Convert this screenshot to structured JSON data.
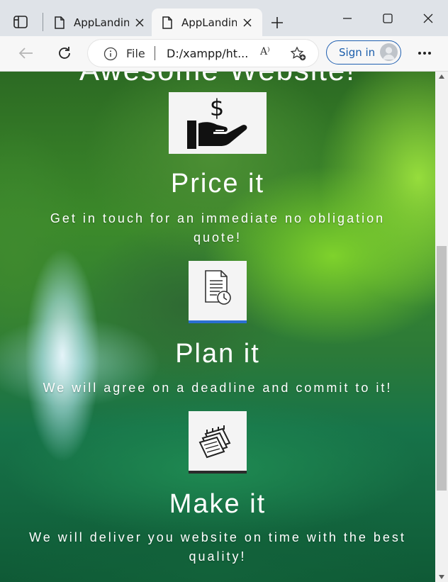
{
  "window": {
    "tabs": [
      {
        "title": "AppLanding",
        "active": false
      },
      {
        "title": "AppLanding",
        "active": true
      }
    ],
    "controls": [
      "minimize-icon",
      "maximize-icon",
      "close-icon"
    ]
  },
  "toolbar": {
    "address": {
      "scheme_label": "File",
      "url": "D:/xampp/ht..."
    },
    "read_aloud_label": "A⁾",
    "signin_label": "Sign in"
  },
  "page": {
    "hero_title": "Awesome Website!",
    "steps": [
      {
        "title": "Price it",
        "description": "Get in touch for an immediate no obligation quote!",
        "icon": "money-hand-icon"
      },
      {
        "title": "Plan it",
        "description": "We will agree on a deadline and commit to it!",
        "icon": "document-clock-icon"
      },
      {
        "title": "Make it",
        "description": "We will deliver you website on time with the best quality!",
        "icon": "calendar-stack-icon"
      }
    ]
  },
  "colors": {
    "accent": "#1a5dab",
    "tabstrip": "#dfe3e8",
    "toolbar": "#f7f7f7"
  }
}
